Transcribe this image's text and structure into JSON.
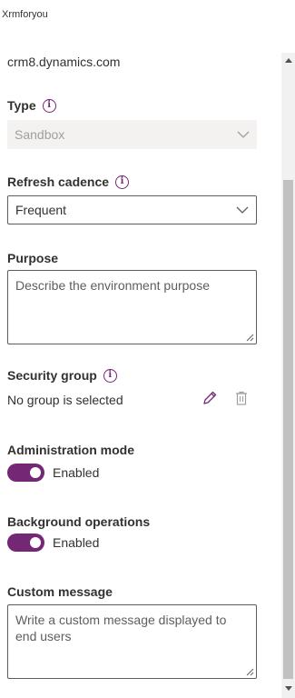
{
  "app": {
    "name": "Xrmforyou"
  },
  "environment": {
    "url": "crm8.dynamics.com"
  },
  "type": {
    "label": "Type",
    "value": "Sandbox"
  },
  "refresh_cadence": {
    "label": "Refresh cadence",
    "value": "Frequent"
  },
  "purpose": {
    "label": "Purpose",
    "placeholder": "Describe the environment purpose"
  },
  "security_group": {
    "label": "Security group",
    "value": "No group is selected"
  },
  "administration_mode": {
    "label": "Administration mode",
    "state": "Enabled"
  },
  "background_operations": {
    "label": "Background operations",
    "state": "Enabled"
  },
  "custom_message": {
    "label": "Custom message",
    "placeholder": "Write a custom message displayed to end users"
  },
  "colors": {
    "accent": "#742774",
    "disabled_bg": "#f3f2f1",
    "border": "#605e5c"
  },
  "icons": [
    "info-icon",
    "chevron-down-icon",
    "pencil-icon",
    "trash-icon"
  ]
}
